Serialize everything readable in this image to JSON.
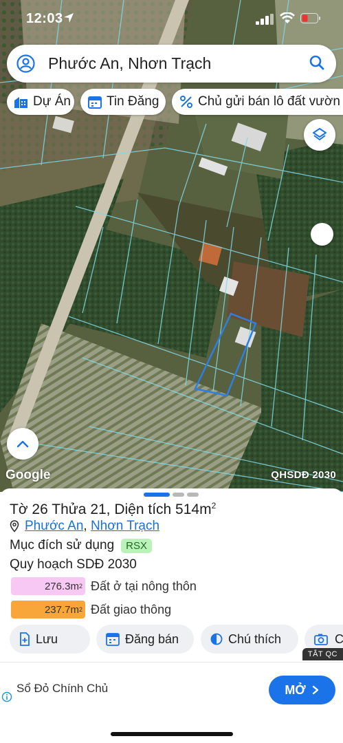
{
  "status": {
    "time": "12:03"
  },
  "search": {
    "query": "Phước An, Nhơn Trạch"
  },
  "chips": [
    {
      "label": "Dự Án"
    },
    {
      "label": "Tin Đăng"
    },
    {
      "label": "Chủ gửi bán lô đất vườn"
    }
  ],
  "map": {
    "attribution": "Google",
    "layer_label": "QHSDĐ 2030"
  },
  "parcel": {
    "title": "Tờ 26 Thửa 21, Diện tích 514m",
    "title_sup": "2",
    "ward": "Phước An",
    "separator": ",",
    "district": "Nhơn Trạch",
    "purpose_label": "Mục đích sử dụng",
    "purpose_code": "RSX",
    "plan_label": "Quy hoạch SDĐ 2030",
    "zones": [
      {
        "area": "276.3m",
        "sup": "2",
        "label": "Đất ở tại nông thôn",
        "color": "#f7c8f3"
      },
      {
        "area": "237.7m",
        "sup": "2",
        "label": "Đất giao thông",
        "color": "#f8a63a"
      }
    ]
  },
  "actions": [
    {
      "label": "Lưu"
    },
    {
      "label": "Đăng bán"
    },
    {
      "label": "Chú thích"
    },
    {
      "label": "C"
    }
  ],
  "ad": {
    "badge": "TẮT QC",
    "text": "Sổ Đỏ Chính Chủ",
    "cta": "MỞ"
  },
  "colors": {
    "accent": "#1a73e8",
    "link": "#1a6fd9",
    "parcel_outline": "#2f7fe0"
  }
}
